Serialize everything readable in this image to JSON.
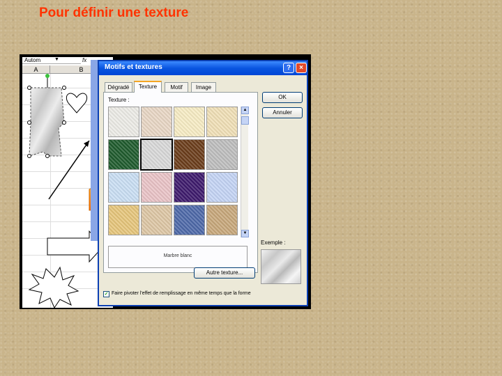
{
  "slide": {
    "title": "Pour définir une texture"
  },
  "excel": {
    "namebox": "Autom",
    "fx": "fx",
    "columns": [
      "A",
      "B"
    ]
  },
  "dialog": {
    "title": "Motifs et textures",
    "help_label": "?",
    "close_label": "×",
    "tabs": [
      "Dégradé",
      "Texture",
      "Motif",
      "Image"
    ],
    "active_tab": "Texture",
    "texture_label": "Texture :",
    "selected_texture_name": "Marbre blanc",
    "ok_label": "OK",
    "cancel_label": "Annuler",
    "other_texture_label": "Autre texture...",
    "example_label": "Exemple :",
    "checkbox_label": "Faire pivoter l'effet de remplissage en même temps que la forme",
    "checkbox_checked": true
  },
  "swatch_colors": [
    [
      "#ecebe6",
      "#e8d6c4",
      "#f6ecc3",
      "#f0dfb6"
    ],
    [
      "#1e5a2c",
      "#d8d8d8",
      "#6a3c1a",
      "#bdbdbd"
    ],
    [
      "#c9def3",
      "#e9c2c6",
      "#3d1a6c",
      "#c3d3f4"
    ],
    [
      "#e6c57a",
      "#ddc6a4",
      "#4d68a8",
      "#c7a77a"
    ]
  ],
  "colors": {
    "title": "#ff3300",
    "titlebar": "#0a55e0",
    "tab_accent": "#f5a623"
  }
}
